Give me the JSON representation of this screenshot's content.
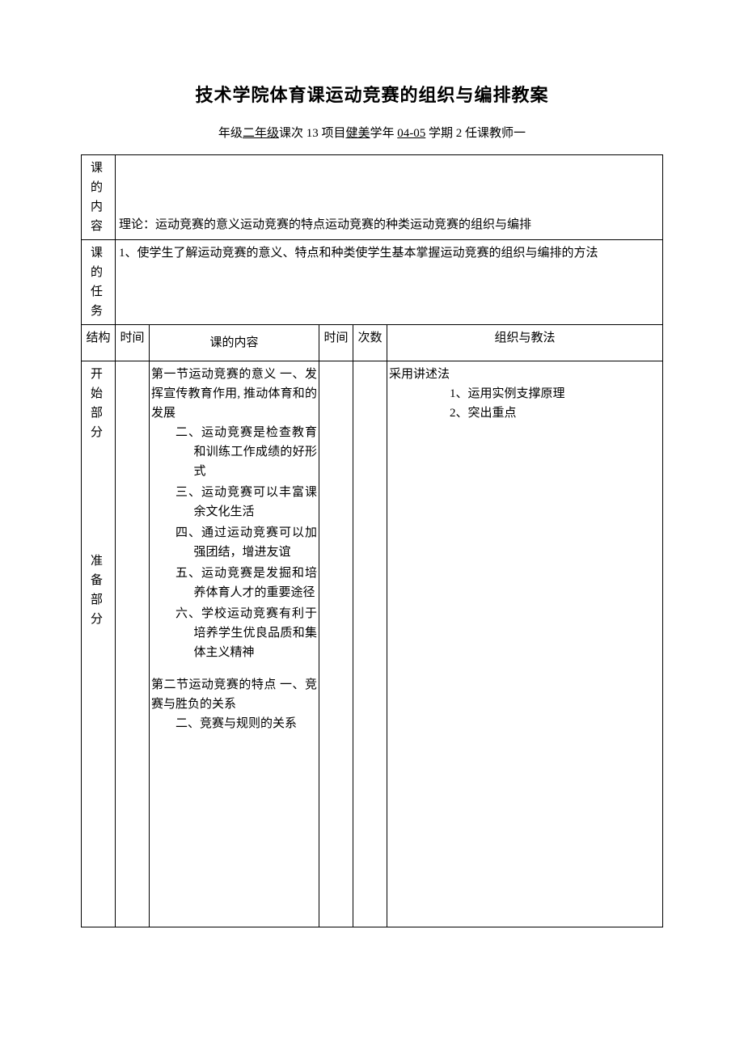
{
  "title": "技术学院体育课运动竞赛的组织与编排教案",
  "info": {
    "grade_lbl": "年级",
    "grade": "二年级",
    "lesson_lbl": "课次",
    "lesson": "13",
    "project_lbl": "项目",
    "project": "健美",
    "year_lbl": "学年",
    "year": "04-05",
    "term_lbl": "学期",
    "term": "2",
    "teacher_lbl": "任课教师",
    "teacher": "一"
  },
  "header": {
    "content_lbl": "课 的内容",
    "content_text": "理论：运动竞赛的意义运动竞赛的特点运动竞赛的种类运动竞赛的组织与编排",
    "task_lbl": "课 的任务",
    "task_text": "1、使学生了解运动竞赛的意义、特点和种类使学生基本掌握运动竞赛的组织与编排的方法"
  },
  "table_head": {
    "c1": "结构",
    "c2": "时间",
    "c3": "课的内容",
    "c4": "时间",
    "c5": "次数",
    "c6": "组织与教法"
  },
  "structure": {
    "start": "开 始部分",
    "prep": "准 备部分"
  },
  "content": {
    "p1": "第一节运动竞赛的意义 一、发挥宣传教育作用, 推动体育和的发展",
    "li2": "二、运动竞赛是检查教育和训练工作成绩的好形式",
    "li3": "三、运动竞赛可以丰富课余文化生活",
    "li4": "四、通过运动竞赛可以加强团结，增进友谊",
    "li5": "五、运动竞赛是发掘和培养体育人才的重要途径",
    "li6": "六、学校运动竞赛有利于培养学生优良品质和集体主义精神",
    "p2": "第二节运动竞赛的特点 一、竞赛与胜负的关系",
    "li2b": "二、竞赛与规则的关系"
  },
  "org": {
    "p1": "采用讲述法",
    "li1": "1、运用实例支撑原理",
    "li2": "2、突出重点"
  }
}
